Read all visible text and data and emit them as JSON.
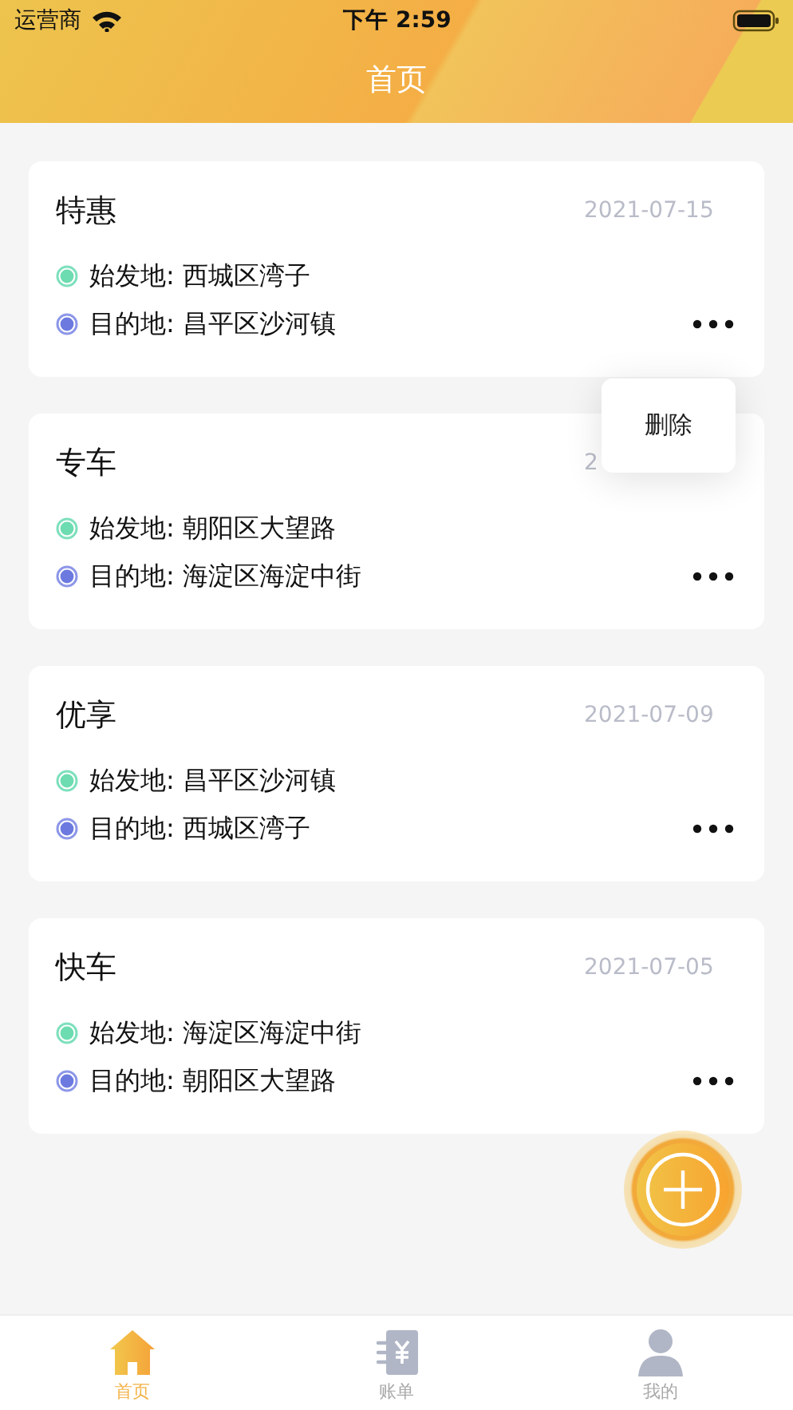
{
  "status_bar": {
    "carrier": "运营商",
    "time": "下午 2:59"
  },
  "header": {
    "title": "首页"
  },
  "orders": [
    {
      "type": "特惠",
      "date": "2021-07-15",
      "origin": "始发地: 西城区湾子",
      "destination": "目的地: 昌平区沙河镇",
      "menu_open": true
    },
    {
      "type": "专车",
      "date": "2",
      "origin": "始发地: 朝阳区大望路",
      "destination": "目的地: 海淀区海淀中街",
      "menu_open": false
    },
    {
      "type": "优享",
      "date": "2021-07-09",
      "origin": "始发地: 昌平区沙河镇",
      "destination": "目的地: 西城区湾子",
      "menu_open": false
    },
    {
      "type": "快车",
      "date": "2021-07-05",
      "origin": "始发地: 海淀区海淀中街",
      "destination": "目的地: 朝阳区大望路",
      "menu_open": false
    }
  ],
  "popup_menu": {
    "items": [
      "删除"
    ]
  },
  "tabs": [
    {
      "label": "首页",
      "kind": "home",
      "selected": true
    },
    {
      "label": "账单",
      "kind": "bill",
      "selected": false
    },
    {
      "label": "我的",
      "kind": "profile",
      "selected": false
    }
  ]
}
